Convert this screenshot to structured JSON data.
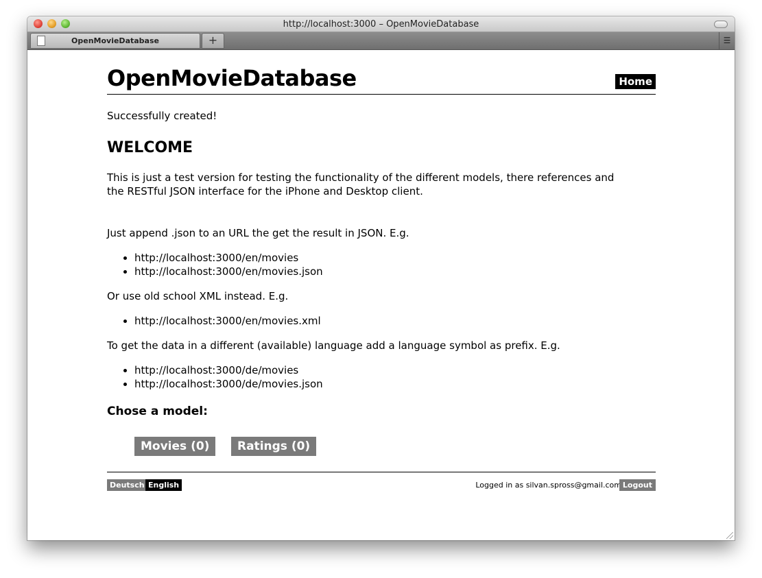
{
  "window": {
    "title": "http://localhost:3000 – OpenMovieDatabase",
    "tab_label": "OpenMovieDatabase",
    "new_tab_label": "+",
    "tab_menu_label": "☰"
  },
  "header": {
    "site_title": "OpenMovieDatabase",
    "home_label": "Home"
  },
  "main": {
    "flash": "Successfully created!",
    "heading": "WELCOME",
    "intro": "This is just a test version for testing the functionality of the different models, there references and the RESTful JSON interface for the iPhone and Desktop client.",
    "json_note": "Just append .json to an URL the get the result in JSON. E.g.",
    "json_links": [
      "http://localhost:3000/en/movies",
      "http://localhost:3000/en/movies.json"
    ],
    "xml_note": "Or use old school XML instead. E.g.",
    "xml_links": [
      "http://localhost:3000/en/movies.xml"
    ],
    "lang_note": "To get the data in a different (available) language add a language symbol as prefix. E.g.",
    "lang_links": [
      "http://localhost:3000/de/movies",
      "http://localhost:3000/de/movies.json"
    ],
    "model_heading": "Chose a model:",
    "models": [
      "Movies (0)",
      "Ratings (0)"
    ]
  },
  "footer": {
    "languages": [
      "Deutsch",
      "English"
    ],
    "logged_in_text": "Logged in as silvan.spross@gmail.com",
    "logout_label": "Logout"
  }
}
